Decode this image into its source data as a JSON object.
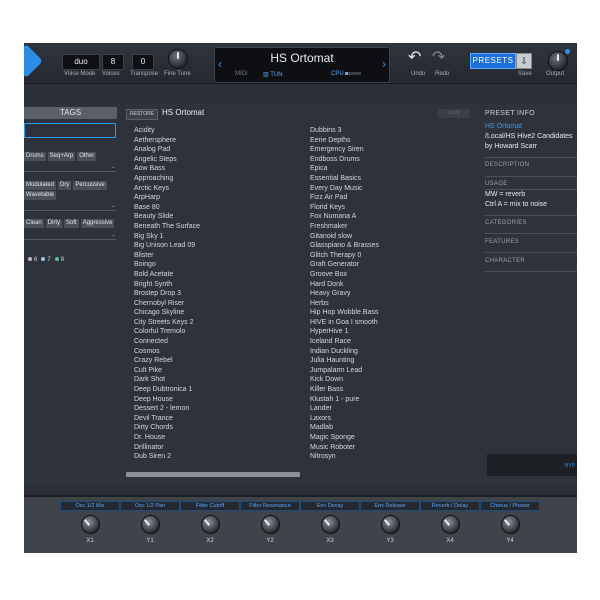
{
  "topbar": {
    "voice_mode": {
      "value": "duo",
      "label": "Voice Mode"
    },
    "voices": {
      "value": "8",
      "label": "Voices"
    },
    "transpose": {
      "value": "0",
      "label": "Transpose"
    },
    "fine_tune_label": "Fine Tune",
    "display": {
      "preset_name": "HS Ortomat",
      "midi_label": "MIDI",
      "tuning_label": "TUN",
      "cpu_label": "CPU"
    },
    "undo_label": "Undo",
    "redo_label": "Redo",
    "presets_label": "PRESETS",
    "save_label": "Save",
    "output_label": "Output"
  },
  "tags_panel": {
    "header": "TAGS",
    "row1": [
      "Drums",
      "Seq+Arp",
      "Other"
    ],
    "row2": [
      "Modulated",
      "Dry",
      "Percussive"
    ],
    "row3": [
      "Wavetable"
    ],
    "row4": [
      "Clean",
      "Dirty",
      "Soft",
      "Aggressive"
    ],
    "color_tags": [
      "6",
      "7",
      "8"
    ]
  },
  "list_header": {
    "restore_label": "RESTORE",
    "title": "HS Ortomat",
    "ready_label": "ready"
  },
  "presets_col1": [
    "Acidity",
    "Aethersphere",
    "Analog Pad",
    "Angelic Steps",
    "Aow Bass",
    "Approaching",
    "Arctic Keys",
    "ArpHarp",
    "Base 80",
    "Beauty Slide",
    "Beneath The Surface",
    "Big Sky 1",
    "Big Unison Lead 09",
    "Blister",
    "Boingo",
    "Bold Acetate",
    "Bright Synth",
    "Brostep Drop 3",
    "Chernobyl Riser",
    "Chicago Skyline",
    "City Streets Keys 2",
    "Colorful Tremolo",
    "Connected",
    "Cosmos",
    "Crazy Rebel",
    "Cult Pike",
    "Dark Shot",
    "Deep Dubtronica 1",
    "Deep House",
    "Dessert 2 - lemon",
    "Devil Trance",
    "Dirty Chords",
    "Dr. House",
    "Drillinator",
    "Dub Siren 2"
  ],
  "presets_col2": [
    "Dubbins 3",
    "Eerie Depths",
    "Emergency Siren",
    "Endboss Drums",
    "Epica",
    "Essential Basics",
    "Every Day Music",
    "Fizz Air Pad",
    "Florid Keys",
    "Fox Numana A",
    "Freshmaker",
    "Gitanoid slow",
    "Glasspiano & Brasses",
    "Glitch Therapy 0",
    "Graft Generator",
    "Groove Box",
    "Hard Donk",
    "Heavy Gravy",
    "Herbs",
    "Hip Hop Wobble Bass",
    "HIVE in Goa I smooth",
    "HyperHive 1",
    "Iceland Race",
    "Indian Duckling",
    "Julia Haunting",
    "Jumpalarm Lead",
    "Kick Down",
    "Killer Bass",
    "Klustah 1 - pure",
    "Lander",
    "Laxors",
    "Madlab",
    "Magic Sponge",
    "Music Roboter",
    "Nitrosyn"
  ],
  "preset_info": {
    "header": "PRESET INFO",
    "name": "HS Ortomat",
    "path": "/Local/HS Hive2 Candidates",
    "author": "by Howard Scarr",
    "description_label": "DESCRIPTION",
    "usage_label": "USAGE",
    "usage_lines": [
      "MW = reverb",
      "Ctrl A = mix to noise"
    ],
    "categories_label": "CATEGORIES",
    "features_label": "FEATURES",
    "character_label": "CHARACTER",
    "bypass_label": "BYP"
  },
  "macros": [
    {
      "label": "Osc 1/2 Mix",
      "name": "X1"
    },
    {
      "label": "Osc 1/2 Pan",
      "name": "Y1"
    },
    {
      "label": "Filter Cutoff",
      "name": "X2"
    },
    {
      "label": "Filter Resonance",
      "name": "Y2"
    },
    {
      "label": "Env Decay",
      "name": "X3"
    },
    {
      "label": "Env Release",
      "name": "Y3"
    },
    {
      "label": "Reverb / Delay",
      "name": "X4"
    },
    {
      "label": "Chorus / Phaser",
      "name": "Y4"
    }
  ],
  "colors": {
    "accent": "#2f8fe6",
    "panel": "#2e333b",
    "macro_label": "#58a6ff"
  },
  "icons": [
    "logo-icon",
    "undo-icon",
    "redo-icon",
    "save-icon",
    "chevron-left-icon",
    "chevron-right-icon"
  ]
}
